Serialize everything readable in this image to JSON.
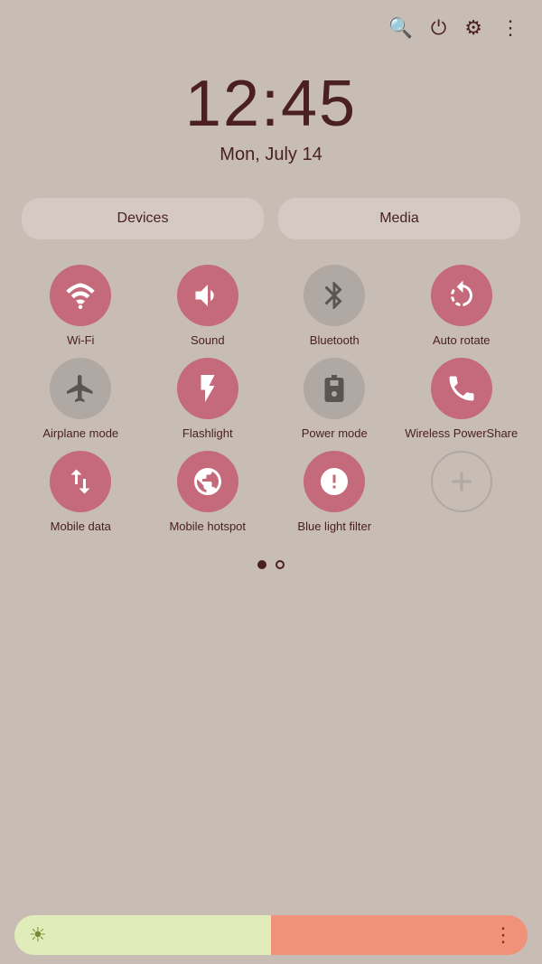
{
  "topbar": {
    "search_icon": "🔍",
    "power_icon": "⏻",
    "settings_icon": "⚙",
    "more_icon": "⋮"
  },
  "clock": {
    "time": "12:45",
    "date": "Mon, July 14"
  },
  "tabs": {
    "devices_label": "Devices",
    "media_label": "Media"
  },
  "tiles": [
    {
      "id": "wifi",
      "label": "Wi-Fi",
      "state": "active"
    },
    {
      "id": "sound",
      "label": "Sound",
      "state": "active"
    },
    {
      "id": "bluetooth",
      "label": "Bluetooth",
      "state": "inactive"
    },
    {
      "id": "autorotate",
      "label": "Auto rotate",
      "state": "active"
    },
    {
      "id": "airplanemode",
      "label": "Airplane mode",
      "state": "inactive"
    },
    {
      "id": "flashlight",
      "label": "Flashlight",
      "state": "active"
    },
    {
      "id": "powermode",
      "label": "Power mode",
      "state": "inactive"
    },
    {
      "id": "wirelesspowershare",
      "label": "Wireless PowerShare",
      "state": "active"
    },
    {
      "id": "mobiledata",
      "label": "Mobile data",
      "state": "active"
    },
    {
      "id": "mobilehotspot",
      "label": "Mobile hotspot",
      "state": "active"
    },
    {
      "id": "bluelightfilter",
      "label": "Blue light filter",
      "state": "active"
    },
    {
      "id": "addtile",
      "label": "",
      "state": "outline"
    }
  ],
  "pagination": {
    "dots": [
      "filled",
      "empty"
    ]
  },
  "bottombar": {
    "sun": "☀",
    "more": "⋮"
  }
}
